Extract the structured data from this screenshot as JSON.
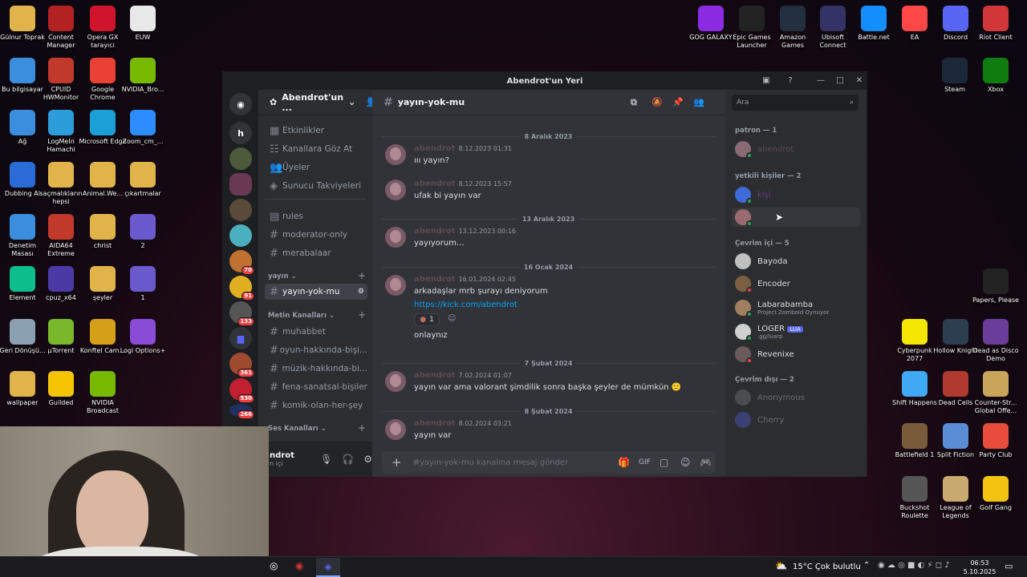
{
  "desktop": {
    "icons": [
      {
        "label": "Gülnur Toprak",
        "color": "#e0b44a"
      },
      {
        "label": "Content Manager",
        "color": "#b22222"
      },
      {
        "label": "Opera GX tarayıcı",
        "color": "#d0142b"
      },
      {
        "label": "EUW",
        "color": "#e8e8e8"
      },
      {
        "label": "Bu bilgisayar",
        "color": "#3b8ede"
      },
      {
        "label": "CPUID HWMonitor",
        "color": "#c0392b"
      },
      {
        "label": "Google Chrome",
        "color": "#e94235"
      },
      {
        "label": "NVIDIA_Bro...",
        "color": "#76b900"
      },
      {
        "label": "Ağ",
        "color": "#3b8ede"
      },
      {
        "label": "LogMeIn Hamachi",
        "color": "#2d9cdb"
      },
      {
        "label": "Microsoft Edge",
        "color": "#1a9fd6"
      },
      {
        "label": "Zoom_cm_...",
        "color": "#2d8cff"
      },
      {
        "label": "Dubbing AI",
        "color": "#2a6bd8"
      },
      {
        "label": "saçmalıkların hepsi",
        "color": "#e0b44a"
      },
      {
        "label": "Animal.We...",
        "color": "#e0b44a"
      },
      {
        "label": "çıkartmalar",
        "color": "#e0b44a"
      },
      {
        "label": "Denetim Masası",
        "color": "#3b8ede"
      },
      {
        "label": "AIDA64 Extreme",
        "color": "#c0392b"
      },
      {
        "label": "christ",
        "color": "#e0b44a"
      },
      {
        "label": "2",
        "color": "#6a5acd"
      },
      {
        "label": "Element",
        "color": "#0dbd8b"
      },
      {
        "label": "cpuz_x64",
        "color": "#4b3aa6"
      },
      {
        "label": "şeyler",
        "color": "#e0b44a"
      },
      {
        "label": "1",
        "color": "#6a5acd"
      },
      {
        "label": "Geri Dönüşü...",
        "color": "#8aa0b0"
      },
      {
        "label": "µTorrent",
        "color": "#78b82a"
      },
      {
        "label": "Konftel Cam...",
        "color": "#d4a017"
      },
      {
        "label": "Logi Options+",
        "color": "#8a4bd6"
      },
      {
        "label": "wallpaper",
        "color": "#e0b44a"
      },
      {
        "label": "Guilded",
        "color": "#f5c400"
      },
      {
        "label": "NVIDIA Broadcast",
        "color": "#76b900"
      }
    ],
    "right_icons": [
      {
        "label": "GOG GALAXY",
        "color": "#8a2be2"
      },
      {
        "label": "Epic Games Launcher",
        "color": "#222222"
      },
      {
        "label": "Amazon Games",
        "color": "#232f3e"
      },
      {
        "label": "Ubisoft Connect",
        "color": "#333366"
      },
      {
        "label": "Battle.net",
        "color": "#148eff"
      },
      {
        "label": "EA",
        "color": "#ff4747"
      },
      {
        "label": "Discord",
        "color": "#5865f2"
      },
      {
        "label": "Riot Client",
        "color": "#d13639"
      },
      {
        "label": "Steam",
        "color": "#1b2838"
      },
      {
        "label": "Xbox",
        "color": "#107c10"
      },
      {
        "label": "Papers, Please",
        "color": "#222222"
      },
      {
        "label": "Cyberpunk 2077",
        "color": "#f3e600"
      },
      {
        "label": "Hollow Knight",
        "color": "#2c3e50"
      },
      {
        "label": "Dead as Disco Demo",
        "color": "#6a3d9a"
      },
      {
        "label": "Shift Happens",
        "color": "#3fa9f5"
      },
      {
        "label": "Dead Cells",
        "color": "#b03a2e"
      },
      {
        "label": "Counter-Str... Global Offe...",
        "color": "#c8a55a"
      },
      {
        "label": "Battlefield 1",
        "color": "#7a5c3c"
      },
      {
        "label": "Split Fiction",
        "color": "#5b8dd6"
      },
      {
        "label": "Party Club",
        "color": "#e74c3c"
      },
      {
        "label": "Buckshot Roulette",
        "color": "#555555"
      },
      {
        "label": "League of Legends",
        "color": "#c8aa6e"
      },
      {
        "label": "Golf Gang",
        "color": "#f1c40f"
      }
    ]
  },
  "discord": {
    "window_title": "Abendrot'un Yeri",
    "server_name": "Abendrot'un ...",
    "guild_letter": "h",
    "guild_badges": [
      "70",
      "91",
      "133",
      "361",
      "530",
      "266"
    ],
    "nav": [
      "Etkinlikler",
      "Kanallara Göz At",
      "Üyeler",
      "Sunucu Takviyeleri"
    ],
    "top_channels": [
      "rules",
      "moderator-only",
      "merabalaar"
    ],
    "cat_yayin": "yayın",
    "active_channel": "yayın-yok-mu",
    "cat_metin": "Metin Kanalları",
    "text_channels": [
      "muhabbet",
      "oyun-hakkında-bişi...",
      "müzik-hakkında-bi...",
      "fena-sanatsal-bişiler",
      "komik-olan-her-şey"
    ],
    "cat_ses": "Ses Kanalları",
    "user_name": "ndrot",
    "user_status": "n içi",
    "channel_header": "yayın-yok-mu",
    "search_placeholder": "Ara",
    "compose_placeholder": "#yayın-yok-mu kanalına mesaj gönder",
    "dates": [
      "8 Aralık 2023",
      "13 Aralık 2023",
      "16 Ocak 2024",
      "7 Şubat 2024",
      "8 Şubat 2024"
    ],
    "messages": [
      {
        "author": "abendrot",
        "time": "8.12.2023 01:31",
        "text": "ııı yayın?"
      },
      {
        "author": "abendrot",
        "time": "8.12.2023 15:57",
        "text": "ufak bi yayın var"
      },
      {
        "author": "abendrot",
        "time": "13.12.2023 00:16",
        "text": "yayıyorum..."
      },
      {
        "author": "abendrot",
        "time": "16.01.2024 02:45",
        "text": "arkadaşlar mrb şurayı deniyorum",
        "link": "https://kick.com/abendrot",
        "reaction_count": "1",
        "extra": "onlaynız"
      },
      {
        "author": "abendrot",
        "time": "7.02.2024 01:07",
        "text": "yayın var ama valorant şimdilik sonra başka şeyler de mümkün 🙂"
      },
      {
        "author": "abendrot",
        "time": "8.02.2024 03:21",
        "text": "yayın var"
      }
    ],
    "member_categories": [
      "patron — 1",
      "yetkili kişiler — 2",
      "Çevrim içi — 5",
      "Çevrim dışı — 2"
    ],
    "members": {
      "patron": [
        {
          "name": "abendrot"
        }
      ],
      "yetkili": [
        {
          "name": "kişi"
        },
        {
          "name": ""
        }
      ],
      "online": [
        {
          "name": "Bayoda",
          "sub": ""
        },
        {
          "name": "Encoder",
          "sub": ""
        },
        {
          "name": "Labarabamba",
          "sub": "Project Zomboid Oynuyor"
        },
        {
          "name": "LOGER",
          "sub": ".gg/luarp",
          "tag": "LUA"
        },
        {
          "name": "Revenixe",
          "sub": ""
        }
      ],
      "offline": [
        {
          "name": "Anonymous"
        },
        {
          "name": "Cherry"
        }
      ]
    }
  },
  "taskbar": {
    "weather": "15°C  Çok bulutlu",
    "time": "06:53",
    "date": "5.10.2025"
  }
}
